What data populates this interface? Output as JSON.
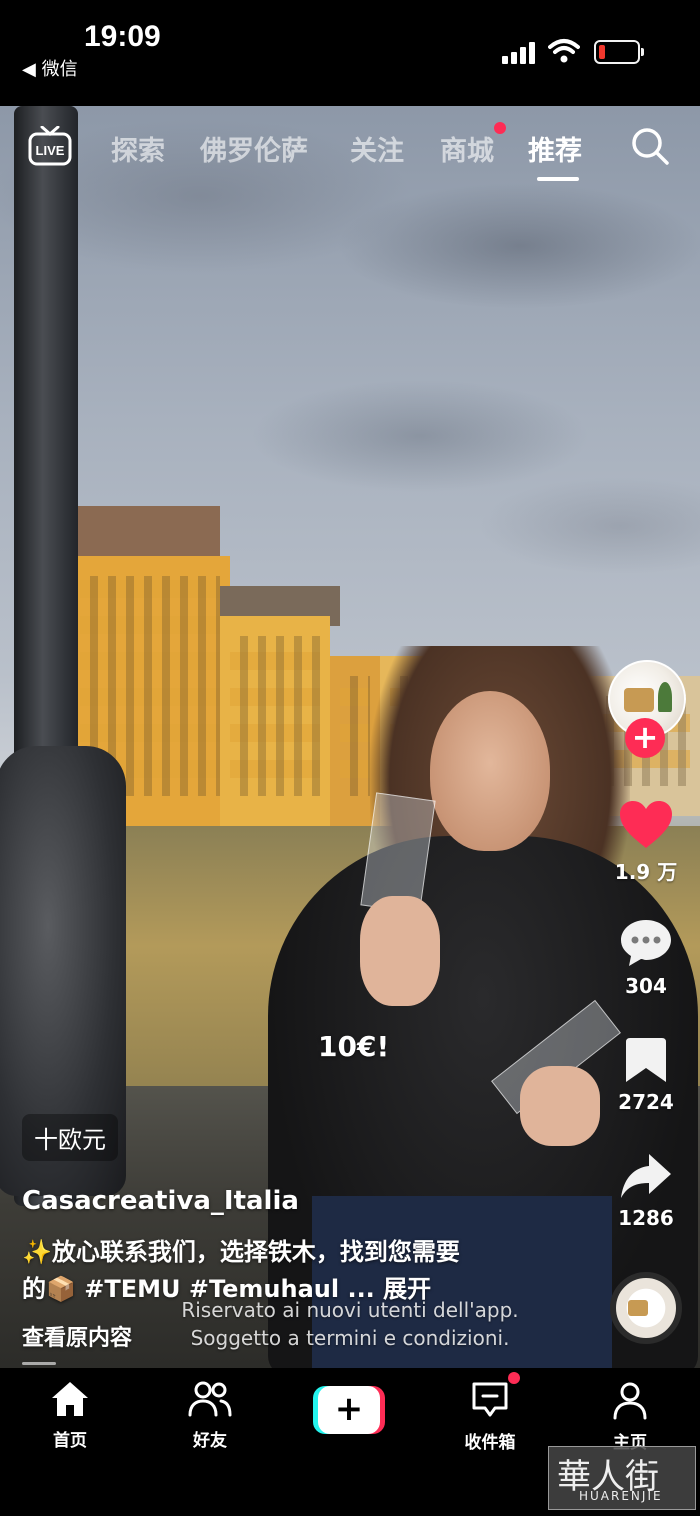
{
  "status_bar": {
    "time": "19:09",
    "back_app": "◀ 微信",
    "battery_color": "#ff3b30"
  },
  "top_nav": {
    "live_label": "LIVE",
    "tabs": [
      {
        "label": "探索"
      },
      {
        "label": "佛罗伦萨"
      },
      {
        "label": "关注"
      },
      {
        "label": "商城"
      },
      {
        "label": "推荐"
      }
    ],
    "active_tab": "推荐",
    "search_icon": "search-icon"
  },
  "side_actions": {
    "follow_label": "+",
    "likes": "1.9 万",
    "comments": "304",
    "bookmarks": "2724",
    "shares": "1286"
  },
  "video": {
    "price_caption": "10€!",
    "sticker_text": "十欧元",
    "author": "Casacreativa_Italia",
    "description_line1": "✨放心联系我们，选择铁木，找到您需要",
    "description_line2": "的📦 #TEMU #Temuhaul ... ",
    "expand_label": "展开",
    "original_label": "查看原内容",
    "legal_line1": "Riservato ai nuovi utenti dell'app.",
    "legal_line2": "Soggetto a termini e condizioni."
  },
  "bottom_nav": {
    "tabs": [
      {
        "label": "首页",
        "icon": "home-icon"
      },
      {
        "label": "好友",
        "icon": "friends-icon"
      },
      {
        "label": "",
        "icon": "create-icon"
      },
      {
        "label": "收件箱",
        "icon": "inbox-icon"
      },
      {
        "label": "主页",
        "icon": "profile-icon"
      }
    ],
    "create_label": "+"
  },
  "watermark": {
    "text_cn": "華人街",
    "text_en": "HUARENJIE"
  },
  "colors": {
    "accent": "#fe2c55",
    "cyan": "#25f4ee",
    "like": "#fe2c55"
  }
}
